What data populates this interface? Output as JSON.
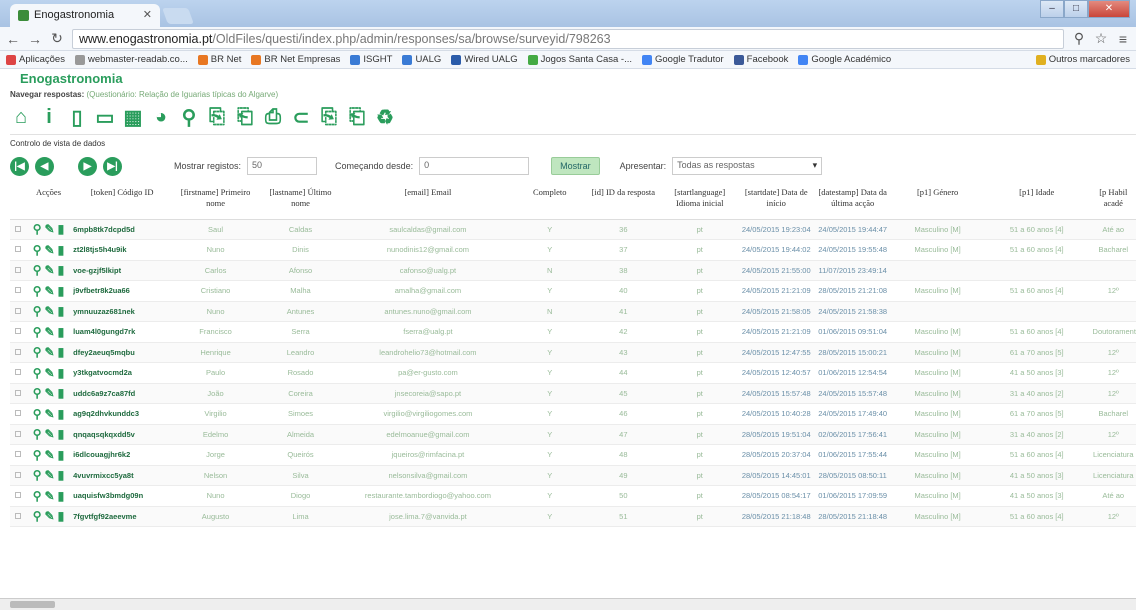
{
  "browser": {
    "tab_title": "Enogastronomia",
    "url_host": "www.enogastronomia.pt",
    "url_path": "/OldFiles/questi/index.php/admin/responses/sa/browse/surveyid/798263",
    "bookmarks": [
      {
        "label": "Aplicações",
        "color": "#d44"
      },
      {
        "label": "webmaster-readab.co...",
        "color": "#999"
      },
      {
        "label": "BR Net",
        "color": "#e87722"
      },
      {
        "label": "BR Net Empresas",
        "color": "#e87722"
      },
      {
        "label": "ISGHT",
        "color": "#3a7bd5"
      },
      {
        "label": "UALG",
        "color": "#3a7bd5"
      },
      {
        "label": "Wired UALG",
        "color": "#2b5caa"
      },
      {
        "label": "Jogos Santa Casa -...",
        "color": "#4a4"
      },
      {
        "label": "Google Tradutor",
        "color": "#4285f4"
      },
      {
        "label": "Facebook",
        "color": "#3b5998"
      },
      {
        "label": "Google Académico",
        "color": "#4285f4"
      },
      {
        "label": "Outros marcadores",
        "color": "#e0b020"
      }
    ]
  },
  "app": {
    "title": "Enogastronomia",
    "subtitle_label": "Navegar respostas:",
    "subtitle_value": "(Questionário: Relação de Iguarias típicas do Algarve)",
    "data_view_label": "Controlo de vista de dados",
    "show_records_label": "Mostrar registos:",
    "show_records_value": "50",
    "start_from_label": "Começando desde:",
    "start_from_value": "0",
    "show_button": "Mostrar",
    "display_label": "Apresentar:",
    "display_value": "Todas as respostas"
  },
  "table": {
    "headers": [
      "",
      "Acções",
      "[token] Código ID",
      "[firstname] Primeiro nome",
      "[lastname] Último nome",
      "[email] Email",
      "Completo",
      "[id] ID da resposta",
      "[startlanguage] Idioma inicial",
      "[startdate] Data de início",
      "[datestamp] Data da última acção",
      "[p1] Género",
      "[p1] Idade",
      "[p Habil acadé"
    ],
    "rows": [
      [
        "6mpb8tk7dcpd5d",
        "Saul",
        "Caldas",
        "saulcaldas@gmail.com",
        "Y",
        "36",
        "pt",
        "24/05/2015 19:23:04",
        "24/05/2015 19:44:47",
        "Masculino [M]",
        "51 a 60 anos [4]",
        "Até ao"
      ],
      [
        "zt2l8tjs5h4u9ik",
        "Nuno",
        "Dinis",
        "nunodinis12@gmail.com",
        "Y",
        "37",
        "pt",
        "24/05/2015 19:44:02",
        "24/05/2015 19:55:48",
        "Masculino [M]",
        "51 a 60 anos [4]",
        "Bacharel"
      ],
      [
        "voe-gzjf5lkipt",
        "Carlos",
        "Afonso",
        "cafonso@ualg.pt",
        "N",
        "38",
        "pt",
        "24/05/2015 21:55:00",
        "11/07/2015 23:49:14",
        "",
        "",
        ""
      ],
      [
        "j9vfbetr8k2ua66",
        "Cristiano",
        "Malha",
        "amalha@gmail.com",
        "Y",
        "40",
        "pt",
        "24/05/2015 21:21:09",
        "28/05/2015 21:21:08",
        "Masculino [M]",
        "51 a 60 anos [4]",
        "12º"
      ],
      [
        "ymnuuzaz681nek",
        "Nuno",
        "Antunes",
        "antunes.nuno@gmail.com",
        "N",
        "41",
        "pt",
        "24/05/2015 21:58:05",
        "24/05/2015 21:58:38",
        "",
        "",
        ""
      ],
      [
        "luam4l0gungd7rk",
        "Francisco",
        "Serra",
        "fserra@ualg.pt",
        "Y",
        "42",
        "pt",
        "24/05/2015 21:21:09",
        "01/06/2015 09:51:04",
        "Masculino [M]",
        "51 a 60 anos [4]",
        "Doutoramento"
      ],
      [
        "dfey2aeuq5mqbu",
        "Henrique",
        "Leandro",
        "leandrohelio73@hotmail.com",
        "Y",
        "43",
        "pt",
        "24/05/2015 12:47:55",
        "28/05/2015 15:00:21",
        "Masculino [M]",
        "61 a 70 anos [5]",
        "12º"
      ],
      [
        "y3tkgatvocmd2a",
        "Paulo",
        "Rosado",
        "pa@er-gusto.com",
        "Y",
        "44",
        "pt",
        "24/05/2015 12:40:57",
        "01/06/2015 12:54:54",
        "Masculino [M]",
        "41 a 50 anos [3]",
        "12º"
      ],
      [
        "uddc6a9z7ca87fd",
        "João",
        "Coreira",
        "jnsecoreia@sapo.pt",
        "Y",
        "45",
        "pt",
        "24/05/2015 15:57:48",
        "24/05/2015 15:57:48",
        "Masculino [M]",
        "31 a 40 anos [2]",
        "12º"
      ],
      [
        "ag9q2dhvkunddc3",
        "Virgilio",
        "Simoes",
        "virgilio@virgiliogomes.com",
        "Y",
        "46",
        "pt",
        "24/05/2015 10:40:28",
        "24/05/2015 17:49:40",
        "Masculino [M]",
        "61 a 70 anos [5]",
        "Bacharel"
      ],
      [
        "qnqaqsqkqxdd5v",
        "Edelmo",
        "Almeida",
        "edelmoanue@gmail.com",
        "Y",
        "47",
        "pt",
        "28/05/2015 19:51:04",
        "02/06/2015 17:56:41",
        "Masculino [M]",
        "31 a 40 anos [2]",
        "12º"
      ],
      [
        "i6dlcouagjhr6k2",
        "Jorge",
        "Queirós",
        "jqueiros@rimfacina.pt",
        "Y",
        "48",
        "pt",
        "28/05/2015 20:37:04",
        "01/06/2015 17:55:44",
        "Masculino [M]",
        "51 a 60 anos [4]",
        "Licenciatura"
      ],
      [
        "4vuvrmixcc5ya8t",
        "Nelson",
        "Silva",
        "nelsonsilva@gmail.com",
        "Y",
        "49",
        "pt",
        "28/05/2015 14:45:01",
        "28/05/2015 08:50:11",
        "Masculino [M]",
        "41 a 50 anos [3]",
        "Licenciatura"
      ],
      [
        "uaquisfw3bmdg09n",
        "Nuno",
        "Diogo",
        "restaurante.tambordiogo@yahoo.com",
        "Y",
        "50",
        "pt",
        "28/05/2015 08:54:17",
        "01/06/2015 17:09:59",
        "Masculino [M]",
        "41 a 50 anos [3]",
        "Até ao"
      ],
      [
        "7fgvtfgf92aeevme",
        "Augusto",
        "Lima",
        "jose.lima.7@vanvida.pt",
        "Y",
        "51",
        "pt",
        "28/05/2015 21:18:48",
        "28/05/2015 21:18:48",
        "Masculino [M]",
        "51 a 60 anos [4]",
        "12º"
      ]
    ]
  }
}
